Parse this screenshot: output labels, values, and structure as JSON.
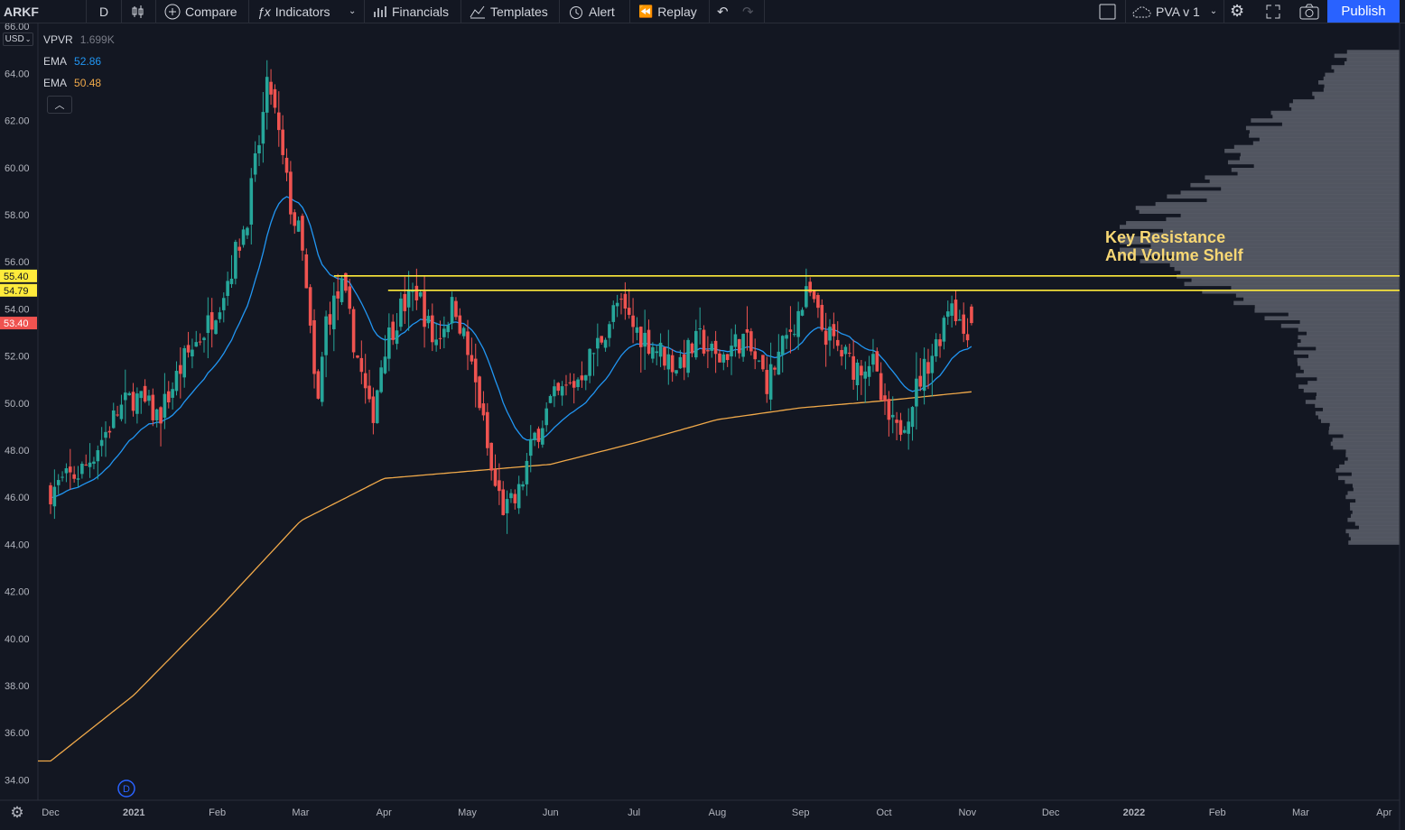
{
  "toolbar": {
    "symbol": "ARKF",
    "interval": "D",
    "compare": "Compare",
    "indicators": "Indicators",
    "financials": "Financials",
    "templates": "Templates",
    "alert": "Alert",
    "replay": "Replay",
    "layout_name": "PVA v 1",
    "publish": "Publish"
  },
  "legend": {
    "vpvr": {
      "name": "VPVR",
      "value": "1.699K"
    },
    "ema_fast": {
      "name": "EMA",
      "value": "52.86"
    },
    "ema_slow": {
      "name": "EMA",
      "value": "50.48"
    }
  },
  "currency": "USD",
  "annotation": [
    "Key Resistance",
    "And Volume Shelf"
  ],
  "colors": {
    "up": "#26a69a",
    "down": "#ef5350",
    "ema_fast": "#2196f3",
    "ema_slow": "#f0a94a",
    "resistance": "#ffeb3b",
    "annotation": "#f7d774",
    "publish": "#2962ff"
  },
  "chart_data": {
    "type": "candlestick",
    "y_ticks": [
      "34.00",
      "36.00",
      "38.00",
      "40.00",
      "42.00",
      "44.00",
      "46.00",
      "48.00",
      "50.00",
      "52.00",
      "54.00",
      "56.00",
      "58.00",
      "60.00",
      "62.00",
      "64.00",
      "66.00"
    ],
    "y_range": [
      33.0,
      66.0
    ],
    "x_labels": [
      "Dec",
      "2021",
      "Feb",
      "Mar",
      "Apr",
      "May",
      "Jun",
      "Jul",
      "Aug",
      "Sep",
      "Oct",
      "Nov",
      "Dec",
      "2022",
      "Feb",
      "Mar",
      "Apr"
    ],
    "price_labels": [
      {
        "value": 55.4,
        "text": "55.40",
        "color": "#ffeb3b"
      },
      {
        "value": 54.79,
        "text": "54.79",
        "color": "#ffeb3b"
      },
      {
        "value": 53.4,
        "text": "53.40",
        "color": "#ef5350"
      }
    ],
    "resistance_levels": [
      {
        "price": 55.4,
        "from_month": 3.4
      },
      {
        "price": 54.79,
        "from_month": 4.05
      }
    ],
    "waypoints": [
      [
        0.0,
        46.3
      ],
      [
        0.4,
        47.2
      ],
      [
        0.8,
        49.6
      ],
      [
        1.0,
        50.3
      ],
      [
        1.3,
        49.4
      ],
      [
        1.6,
        51.8
      ],
      [
        1.9,
        53.4
      ],
      [
        2.1,
        55.0
      ],
      [
        2.35,
        57.8
      ],
      [
        2.5,
        61.0
      ],
      [
        2.62,
        63.8
      ],
      [
        2.75,
        61.0
      ],
      [
        2.9,
        58.0
      ],
      [
        3.0,
        57.0
      ],
      [
        3.1,
        53.6
      ],
      [
        3.2,
        49.5
      ],
      [
        3.3,
        53.5
      ],
      [
        3.5,
        54.9
      ],
      [
        3.65,
        52.5
      ],
      [
        3.85,
        49.2
      ],
      [
        4.0,
        52.4
      ],
      [
        4.2,
        54.0
      ],
      [
        4.4,
        54.8
      ],
      [
        4.6,
        52.5
      ],
      [
        4.85,
        54.3
      ],
      [
        5.0,
        52.2
      ],
      [
        5.15,
        50.0
      ],
      [
        5.3,
        46.8
      ],
      [
        5.45,
        45.4
      ],
      [
        5.6,
        45.9
      ],
      [
        5.8,
        48.5
      ],
      [
        6.0,
        50.0
      ],
      [
        6.3,
        50.9
      ],
      [
        6.55,
        52.4
      ],
      [
        6.8,
        54.2
      ],
      [
        7.0,
        53.2
      ],
      [
        7.25,
        52.4
      ],
      [
        7.5,
        51.6
      ],
      [
        7.8,
        52.7
      ],
      [
        8.0,
        51.8
      ],
      [
        8.3,
        52.8
      ],
      [
        8.6,
        50.9
      ],
      [
        8.9,
        53.3
      ],
      [
        9.1,
        54.7
      ],
      [
        9.25,
        53.2
      ],
      [
        9.45,
        52.3
      ],
      [
        9.65,
        51.5
      ],
      [
        9.85,
        51.9
      ],
      [
        10.0,
        49.6
      ],
      [
        10.15,
        48.7
      ],
      [
        10.3,
        49.8
      ],
      [
        10.45,
        51.2
      ],
      [
        10.65,
        52.7
      ],
      [
        10.8,
        54.6
      ],
      [
        10.95,
        53.0
      ],
      [
        11.05,
        53.4
      ]
    ],
    "ema_fast": {
      "name": "EMA",
      "last": 52.86
    },
    "ema_slow": {
      "name": "EMA",
      "last": 50.48
    },
    "volume_profile_range": [
      44.0,
      65.0
    ]
  }
}
